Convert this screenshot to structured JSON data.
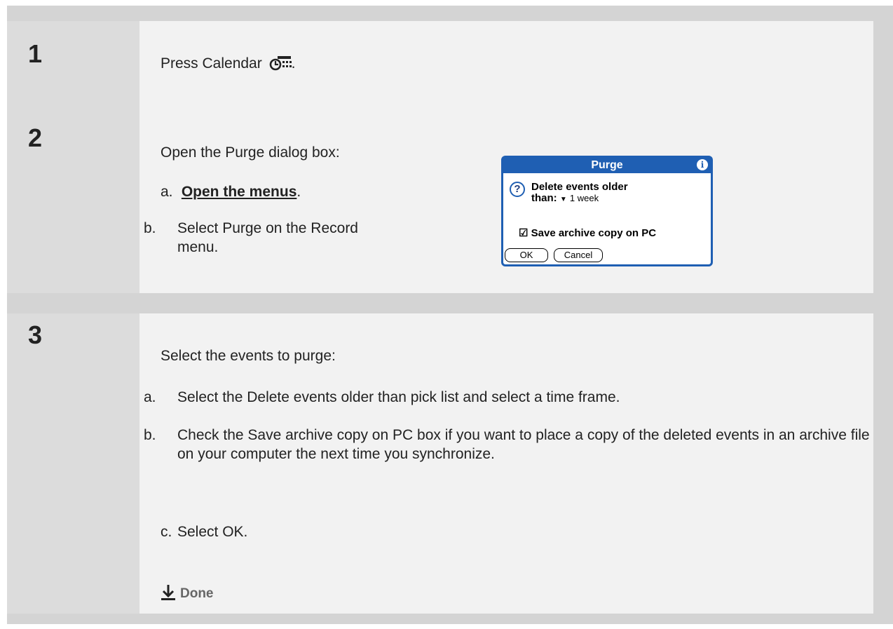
{
  "steps": [
    {
      "number": "1",
      "text_before_icon": "Press Calendar",
      "text_after_icon": "."
    },
    {
      "number": "2",
      "intro": "Open the Purge dialog box:",
      "items": [
        {
          "label": "a.",
          "link": "Open the menus",
          "suffix": "."
        },
        {
          "label": "b.",
          "text": "Select Purge on the Record menu."
        }
      ],
      "dialog": {
        "title": "Purge",
        "question_line1": "Delete events older",
        "question_label": "than:",
        "pick_value": "1 week",
        "checkbox_label": "Save archive copy on PC",
        "ok_label": "OK",
        "cancel_label": "Cancel"
      }
    },
    {
      "number": "3",
      "intro": "Select the events to purge:",
      "items": [
        {
          "label": "a.",
          "text": "Select the Delete events older than pick list and select a time frame."
        },
        {
          "label": "b.",
          "text": "Check the Save archive copy on PC box if you want to place a copy of the deleted events in an archive file on your computer the next time you synchronize."
        },
        {
          "label": "c.",
          "text": "Select OK."
        }
      ],
      "done_label": "Done"
    }
  ],
  "colors": {
    "dialog_blue": "#1f5fb3",
    "step_bg": "#dcdcdc",
    "body_bg": "#f2f2f2"
  }
}
